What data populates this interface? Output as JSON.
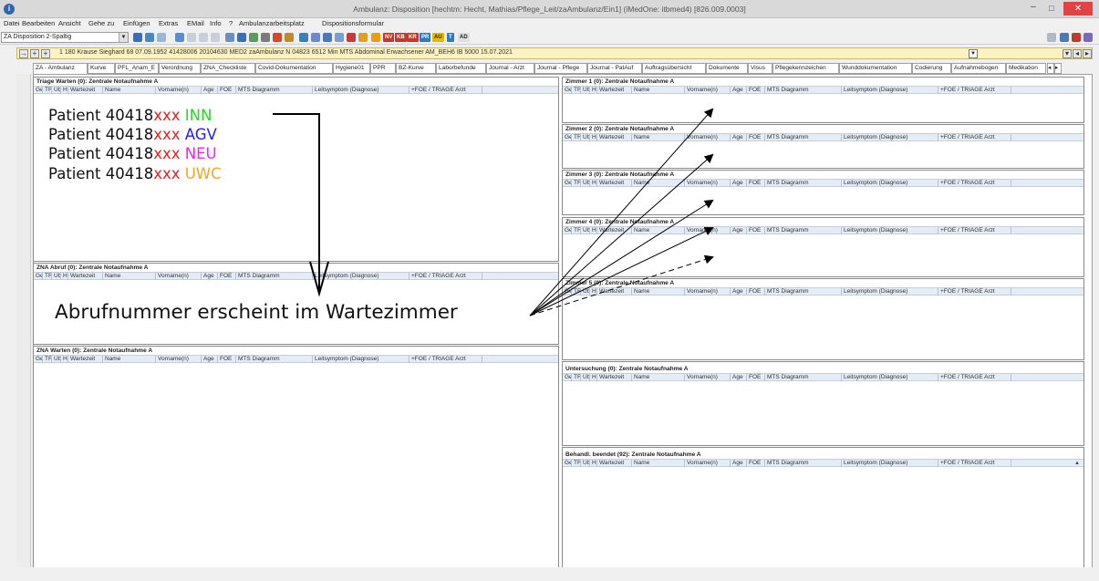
{
  "window": {
    "title": "Ambulanz: Disposition [hechtm: Hecht, Mathias/Pflege_Leit/zaAmbulanz/Ein1] (iMedOne: itbmed4) [826.009.0003]",
    "min": "–",
    "max": "□",
    "close": "✕"
  },
  "menu": [
    "Datei",
    "Bearbeiten",
    "Ansicht",
    "Gehe zu",
    "Einfügen",
    "Extras",
    "EMail",
    "Info",
    "?",
    "Ambulanzarbeitsplatz",
    "Dispositionsformular"
  ],
  "toolbar": {
    "layout_select": "ZA Disposition 2-Spaltig",
    "tags": [
      "NV",
      "KB",
      "KR",
      "PR",
      "AU",
      "T",
      "AD"
    ]
  },
  "patient_bar": {
    "text": "1 180 Krause Sieghard 68 07.09.1952 41428006 20104630 MED2 zaAmbulanz N 04823 6512 Min MTS Abdominal Erwachsener AM_BEH6 IB 5000 15.07.2021"
  },
  "tabs": [
    "ZA - Ambulanz",
    "Kurve",
    "PFL_Anam_E",
    "Verordnung",
    "ZNA_Checkliste",
    "Covid-Dokumentation",
    "Hygiene01",
    "PPR",
    "BZ-Kurve",
    "Laborbefunde",
    "Journal - Arzt",
    "Journal - Pflege",
    "Journal - PatAuf",
    "Auftragsübersicht",
    "Dokumente",
    "Visus",
    "Pflegekennzeichen",
    "Wunddokumentation",
    "Codierung",
    "Aufnahmebogen",
    "Medikation"
  ],
  "columns": [
    "Ge",
    "TR",
    "Üb",
    "H",
    "Wartezeit",
    "Name",
    "Vorname(n)",
    "Age",
    "FOE",
    "MTS Diagramm",
    "Leitsymptom (Diagnose)",
    "+FOE / TRIAGE Arzt"
  ],
  "panels": {
    "triage": "Triage Warten (0): Zentrale Notaufnahme A",
    "abruf": "ZNA Abruf (0): Zentrale Notaufnahme A",
    "warten": "ZNA Warten (0): Zentrale Notaufnahme A",
    "zimmer1": "Zimmer 1 (0): Zentrale Notaufnahme A",
    "zimmer2": "Zimmer 2 (0): Zentrale Notaufnahme A",
    "zimmer3": "Zimmer 3 (0): Zentrale Notaufnahme A",
    "zimmer4": "Zimmer 4 (0): Zentrale Notaufnahme A",
    "zimmer5": "Zimmer 5 (0): Zentrale Notaufnahme A",
    "untersuchung": "Untersuchung (0): Zentrale Notaufnahme A",
    "beendet": "Behandl. beendet (92): Zentrale Notaufnahme A"
  },
  "annotations": {
    "patients": [
      {
        "prefix": "Patient 40418",
        "suffix": "xxx",
        "code": "INN",
        "code_color": "#22dd22"
      },
      {
        "prefix": "Patient 40418",
        "suffix": "xxx",
        "code": "AGV",
        "code_color": "#2222ee"
      },
      {
        "prefix": "Patient 40418",
        "suffix": "xxx",
        "code": "NEU",
        "code_color": "#ee22ee"
      },
      {
        "prefix": "Patient 40418",
        "suffix": "xxx",
        "code": "UWC",
        "code_color": "#f5a623"
      }
    ],
    "main": "Abrufnummer erscheint im Wartezimmer"
  }
}
